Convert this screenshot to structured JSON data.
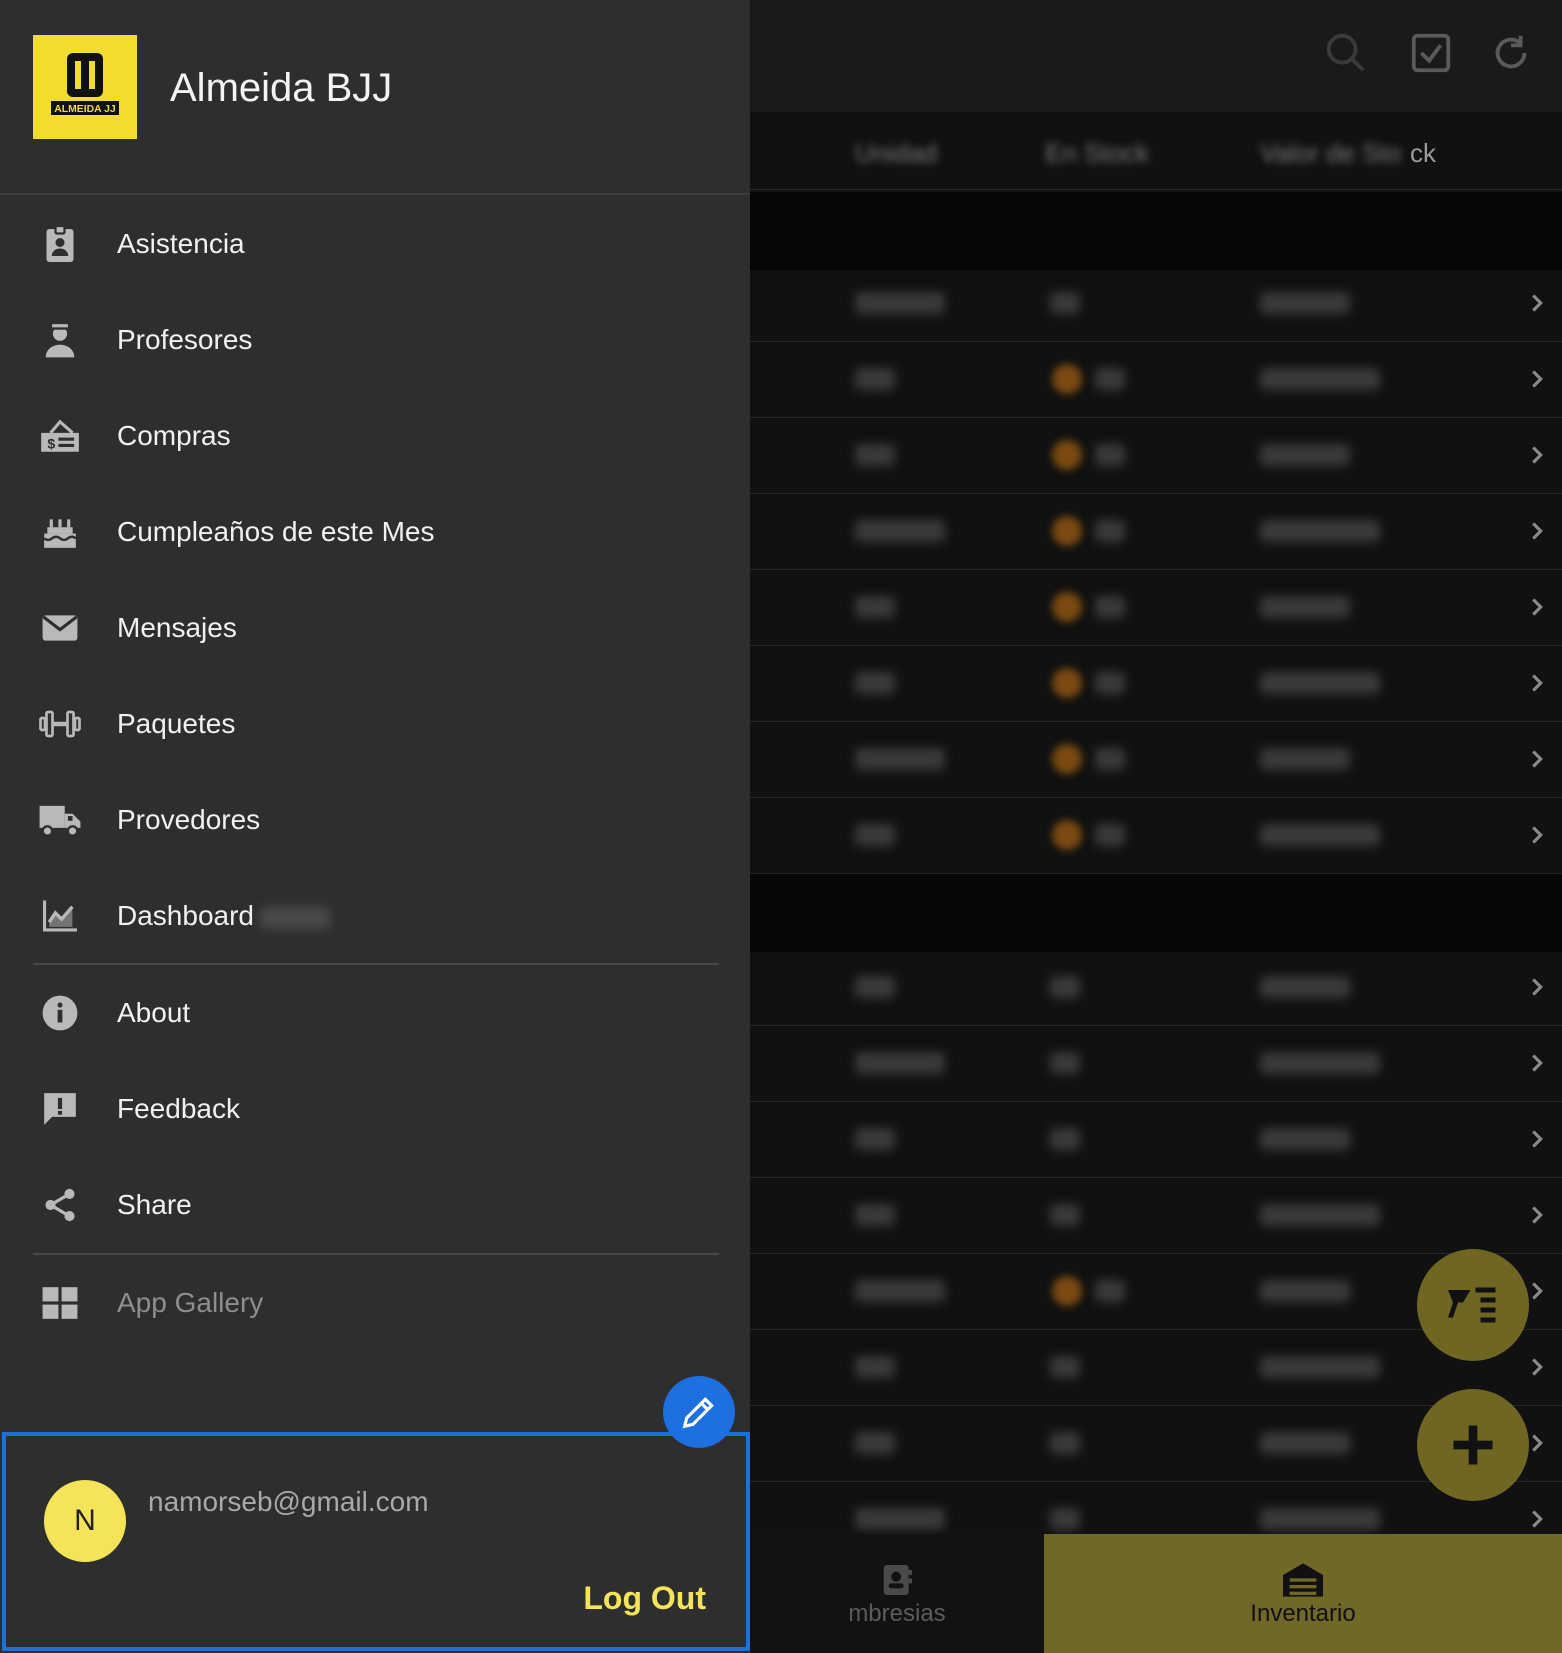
{
  "drawer": {
    "org_name": "Almeida BJJ",
    "logo_text": "ALMEIDA JJ",
    "menu": [
      {
        "label": "Asistencia",
        "icon": "id-badge-icon"
      },
      {
        "label": "Profesores",
        "icon": "teacher-icon"
      },
      {
        "label": "Compras",
        "icon": "purchase-icon"
      },
      {
        "label": "Cumpleaños de este Mes",
        "icon": "birthday-cake-icon"
      },
      {
        "label": "Mensajes",
        "icon": "envelope-icon"
      },
      {
        "label": "Paquetes",
        "icon": "dumbbell-icon"
      },
      {
        "label": "Provedores",
        "icon": "truck-icon"
      },
      {
        "label": "Dashboard",
        "icon": "chart-icon"
      }
    ],
    "secondary": [
      {
        "label": "About",
        "icon": "info-icon"
      },
      {
        "label": "Feedback",
        "icon": "feedback-icon"
      },
      {
        "label": "Share",
        "icon": "share-icon"
      }
    ],
    "app_gallery": {
      "label": "App Gallery",
      "icon": "grid-icon"
    },
    "account": {
      "initial": "N",
      "email": "namorseb@gmail.com",
      "logout_label": "Log Out"
    }
  },
  "background": {
    "header_partial": "ck",
    "bottom_nav": [
      {
        "label": "mbresias",
        "icon": "contact-card-icon"
      },
      {
        "label": "Inventario",
        "icon": "warehouse-icon"
      }
    ]
  },
  "colors": {
    "drawer_bg": "#2e2e2f",
    "accent_yellow": "#f5e35a",
    "accent_blue": "#1e6fe0",
    "fab_olive": "#6f6621"
  }
}
